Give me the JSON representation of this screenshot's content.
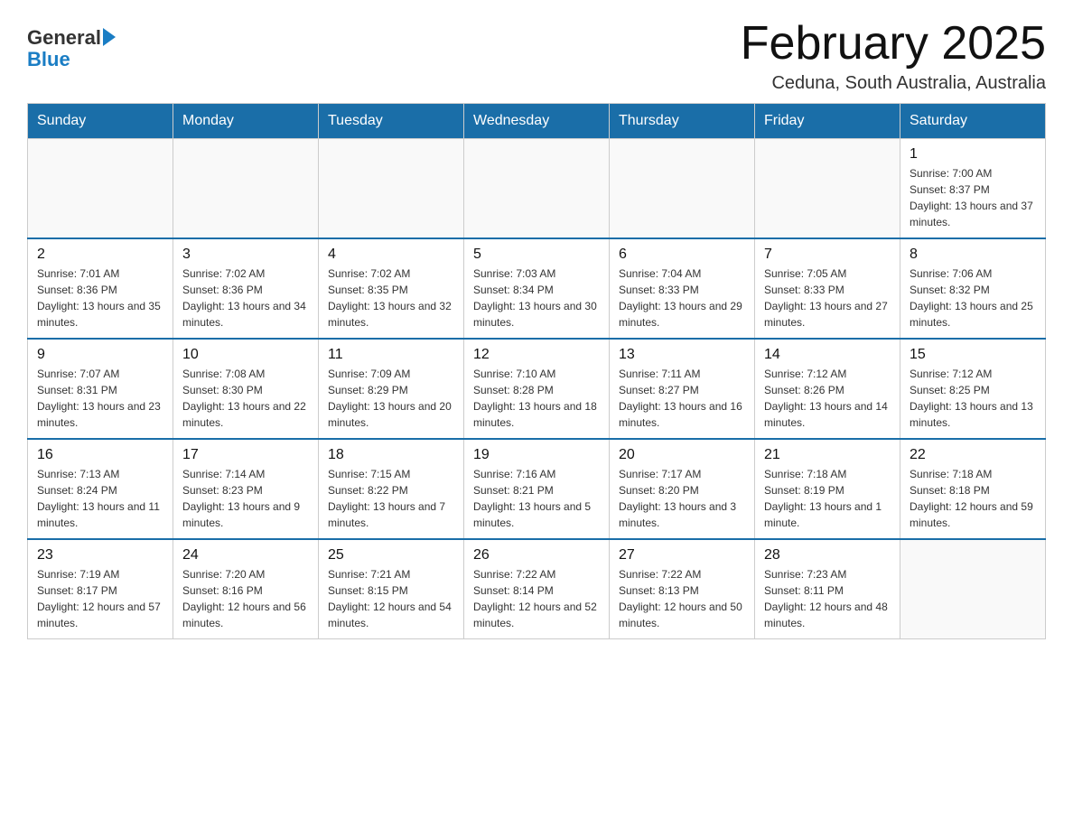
{
  "logo": {
    "text_general": "General",
    "text_blue": "Blue"
  },
  "title": "February 2025",
  "subtitle": "Ceduna, South Australia, Australia",
  "days_of_week": [
    "Sunday",
    "Monday",
    "Tuesday",
    "Wednesday",
    "Thursday",
    "Friday",
    "Saturday"
  ],
  "weeks": [
    [
      {
        "day": "",
        "info": ""
      },
      {
        "day": "",
        "info": ""
      },
      {
        "day": "",
        "info": ""
      },
      {
        "day": "",
        "info": ""
      },
      {
        "day": "",
        "info": ""
      },
      {
        "day": "",
        "info": ""
      },
      {
        "day": "1",
        "info": "Sunrise: 7:00 AM\nSunset: 8:37 PM\nDaylight: 13 hours and 37 minutes."
      }
    ],
    [
      {
        "day": "2",
        "info": "Sunrise: 7:01 AM\nSunset: 8:36 PM\nDaylight: 13 hours and 35 minutes."
      },
      {
        "day": "3",
        "info": "Sunrise: 7:02 AM\nSunset: 8:36 PM\nDaylight: 13 hours and 34 minutes."
      },
      {
        "day": "4",
        "info": "Sunrise: 7:02 AM\nSunset: 8:35 PM\nDaylight: 13 hours and 32 minutes."
      },
      {
        "day": "5",
        "info": "Sunrise: 7:03 AM\nSunset: 8:34 PM\nDaylight: 13 hours and 30 minutes."
      },
      {
        "day": "6",
        "info": "Sunrise: 7:04 AM\nSunset: 8:33 PM\nDaylight: 13 hours and 29 minutes."
      },
      {
        "day": "7",
        "info": "Sunrise: 7:05 AM\nSunset: 8:33 PM\nDaylight: 13 hours and 27 minutes."
      },
      {
        "day": "8",
        "info": "Sunrise: 7:06 AM\nSunset: 8:32 PM\nDaylight: 13 hours and 25 minutes."
      }
    ],
    [
      {
        "day": "9",
        "info": "Sunrise: 7:07 AM\nSunset: 8:31 PM\nDaylight: 13 hours and 23 minutes."
      },
      {
        "day": "10",
        "info": "Sunrise: 7:08 AM\nSunset: 8:30 PM\nDaylight: 13 hours and 22 minutes."
      },
      {
        "day": "11",
        "info": "Sunrise: 7:09 AM\nSunset: 8:29 PM\nDaylight: 13 hours and 20 minutes."
      },
      {
        "day": "12",
        "info": "Sunrise: 7:10 AM\nSunset: 8:28 PM\nDaylight: 13 hours and 18 minutes."
      },
      {
        "day": "13",
        "info": "Sunrise: 7:11 AM\nSunset: 8:27 PM\nDaylight: 13 hours and 16 minutes."
      },
      {
        "day": "14",
        "info": "Sunrise: 7:12 AM\nSunset: 8:26 PM\nDaylight: 13 hours and 14 minutes."
      },
      {
        "day": "15",
        "info": "Sunrise: 7:12 AM\nSunset: 8:25 PM\nDaylight: 13 hours and 13 minutes."
      }
    ],
    [
      {
        "day": "16",
        "info": "Sunrise: 7:13 AM\nSunset: 8:24 PM\nDaylight: 13 hours and 11 minutes."
      },
      {
        "day": "17",
        "info": "Sunrise: 7:14 AM\nSunset: 8:23 PM\nDaylight: 13 hours and 9 minutes."
      },
      {
        "day": "18",
        "info": "Sunrise: 7:15 AM\nSunset: 8:22 PM\nDaylight: 13 hours and 7 minutes."
      },
      {
        "day": "19",
        "info": "Sunrise: 7:16 AM\nSunset: 8:21 PM\nDaylight: 13 hours and 5 minutes."
      },
      {
        "day": "20",
        "info": "Sunrise: 7:17 AM\nSunset: 8:20 PM\nDaylight: 13 hours and 3 minutes."
      },
      {
        "day": "21",
        "info": "Sunrise: 7:18 AM\nSunset: 8:19 PM\nDaylight: 13 hours and 1 minute."
      },
      {
        "day": "22",
        "info": "Sunrise: 7:18 AM\nSunset: 8:18 PM\nDaylight: 12 hours and 59 minutes."
      }
    ],
    [
      {
        "day": "23",
        "info": "Sunrise: 7:19 AM\nSunset: 8:17 PM\nDaylight: 12 hours and 57 minutes."
      },
      {
        "day": "24",
        "info": "Sunrise: 7:20 AM\nSunset: 8:16 PM\nDaylight: 12 hours and 56 minutes."
      },
      {
        "day": "25",
        "info": "Sunrise: 7:21 AM\nSunset: 8:15 PM\nDaylight: 12 hours and 54 minutes."
      },
      {
        "day": "26",
        "info": "Sunrise: 7:22 AM\nSunset: 8:14 PM\nDaylight: 12 hours and 52 minutes."
      },
      {
        "day": "27",
        "info": "Sunrise: 7:22 AM\nSunset: 8:13 PM\nDaylight: 12 hours and 50 minutes."
      },
      {
        "day": "28",
        "info": "Sunrise: 7:23 AM\nSunset: 8:11 PM\nDaylight: 12 hours and 48 minutes."
      },
      {
        "day": "",
        "info": ""
      }
    ]
  ]
}
